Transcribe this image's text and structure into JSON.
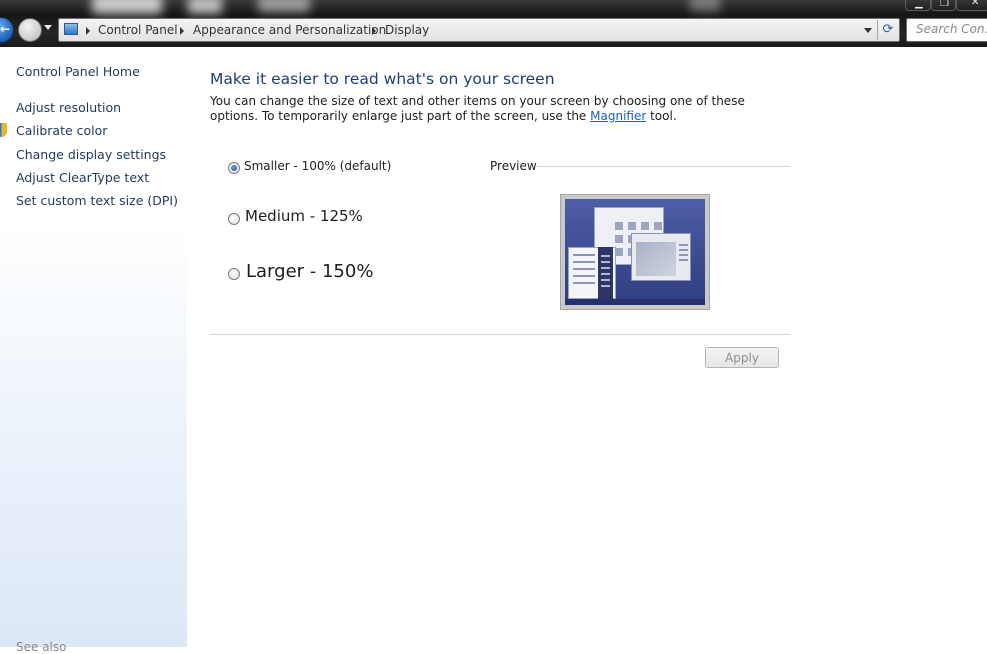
{
  "address_bar": {
    "breadcrumbs": [
      "Control Panel",
      "Appearance and Personalization",
      "Display"
    ]
  },
  "search": {
    "placeholder": "Search Con..."
  },
  "sidebar": {
    "home": "Control Panel Home",
    "links": [
      "Adjust resolution",
      "Calibrate color",
      "Change display settings",
      "Adjust ClearType text",
      "Set custom text size (DPI)"
    ],
    "see_also": "See also"
  },
  "main": {
    "heading": "Make it easier to read what's on your screen",
    "description_before": "You can change the size of text and other items on your screen by choosing one of these options. To temporarily enlarge just part of the screen, use the ",
    "description_link": "Magnifier",
    "description_after": " tool.",
    "options": [
      {
        "label": "Smaller - 100% (default)",
        "selected": true
      },
      {
        "label": "Medium - 125%",
        "selected": false
      },
      {
        "label": "Larger - 150%",
        "selected": false
      }
    ],
    "preview_label": "Preview",
    "apply_label": "Apply"
  },
  "colors": {
    "heading": "#1f3d7a",
    "link": "#1a60c0",
    "sidebar_link": "#1e3a5f"
  },
  "icons": [
    "back-arrow-icon",
    "forward-arrow-icon",
    "control-panel-icon",
    "refresh-icon",
    "shield-icon",
    "minimize-icon",
    "maximize-icon",
    "close-icon"
  ]
}
